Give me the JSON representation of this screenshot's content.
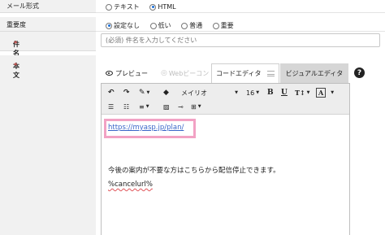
{
  "mail_format": {
    "label": "メール形式",
    "options": [
      "テキスト",
      "HTML"
    ],
    "selected": "HTML"
  },
  "importance": {
    "label": "重要度",
    "options": [
      "設定なし",
      "低い",
      "普通",
      "重要"
    ],
    "selected": "設定なし"
  },
  "subject": {
    "label": "件名",
    "required_mark": "*",
    "placeholder": "(必須) 件名を入力してください"
  },
  "body": {
    "label": "本文",
    "required_mark": "*",
    "tabs": {
      "preview": "プレビュー",
      "web_beacon": "Webビーコン",
      "code_editor": "コードエディタ",
      "visual_editor": "ビジュアルエディタ"
    },
    "help": "?",
    "toolbar": {
      "font": "メイリオ",
      "font_size": "16",
      "bold": "B",
      "underline": "U",
      "text_size": "T↕",
      "text_color": "A"
    },
    "content": {
      "link": "https://myasp.jp/plan/",
      "text": "今後の案内が不要な方はこちらから配信停止できます。",
      "cancel_url": "%cancelurl%"
    }
  },
  "colors": {
    "highlight": "#f2a2c4",
    "link": "#3a66c8",
    "radio_selected": "#1a6fd8",
    "required": "#d9534f"
  }
}
